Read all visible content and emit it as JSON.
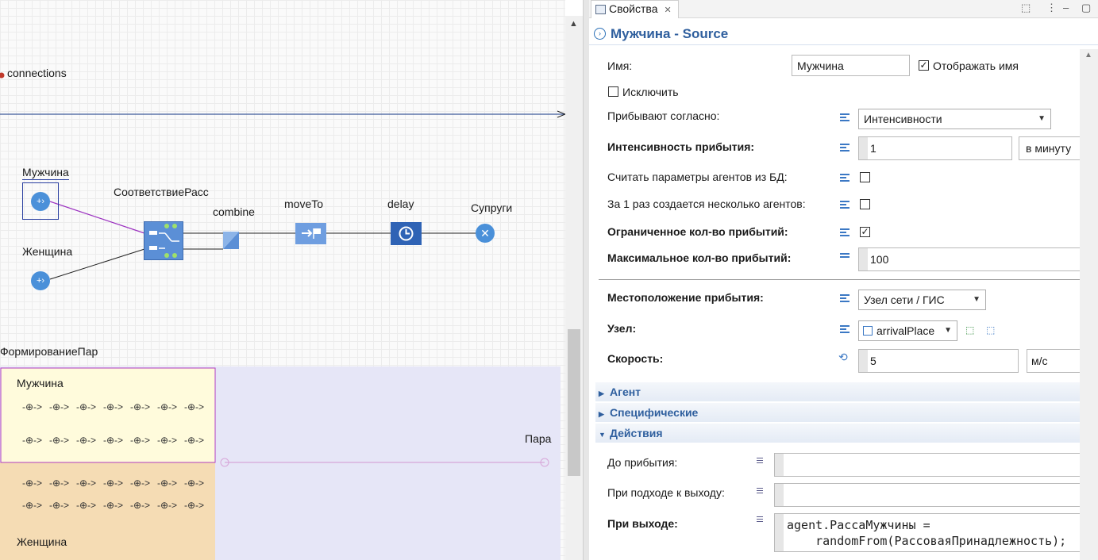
{
  "canvas": {
    "connections_label": "connections",
    "nodes": {
      "man": "Мужчина",
      "woman": "Женщина",
      "match": "СоответствиеРасс",
      "combine": "combine",
      "moveto": "moveTo",
      "delay": "delay",
      "spouses": "Супруги"
    },
    "pairing": {
      "title": "ФормированиеПар",
      "man_label": "Мужчина",
      "woman_label": "Женщина",
      "pair_label": "Пара",
      "agent_glyph": "-⊕->"
    }
  },
  "panel": {
    "tab_title": "Свойства",
    "header_title": "Мужчина - Source",
    "name_label": "Имя:",
    "name_value": "Мужчина",
    "show_name_label": "Отображать имя",
    "exclude_label": "Исключить",
    "arrive_by_label": "Прибывают согласно:",
    "arrive_by_value": "Интенсивности",
    "rate_label": "Интенсивность прибытия:",
    "rate_value": "1",
    "rate_unit": "в минуту",
    "read_db_label": "Считать параметры агентов из БД:",
    "multi_label": "За 1 раз создается несколько агентов:",
    "limited_label": "Ограниченное кол-во прибытий:",
    "max_label": "Максимальное кол-во прибытий:",
    "max_value": "100",
    "location_label": "Местоположение прибытия:",
    "location_value": "Узел сети / ГИС",
    "node_label": "Узел:",
    "node_value": "arrivalPlace",
    "speed_label": "Скорость:",
    "speed_value": "5",
    "speed_unit": "м/с",
    "sections": {
      "agent": "Агент",
      "specific": "Специфические",
      "actions": "Действия"
    },
    "before_arrival_label": "До прибытия:",
    "on_approach_label": "При подходе к выходу:",
    "on_exit_label": "При выходе:",
    "on_exit_code_1": "agent.РассаМужчины =",
    "on_exit_code_2": "    randomFrom(РассоваяПринадлежность);"
  },
  "colors": {
    "accent": "#2f5f9e",
    "node_blue": "#4a90d9",
    "man_area": "#fffbdc",
    "woman_area": "#f5dcb4",
    "pair_area": "#e6e6f7"
  }
}
